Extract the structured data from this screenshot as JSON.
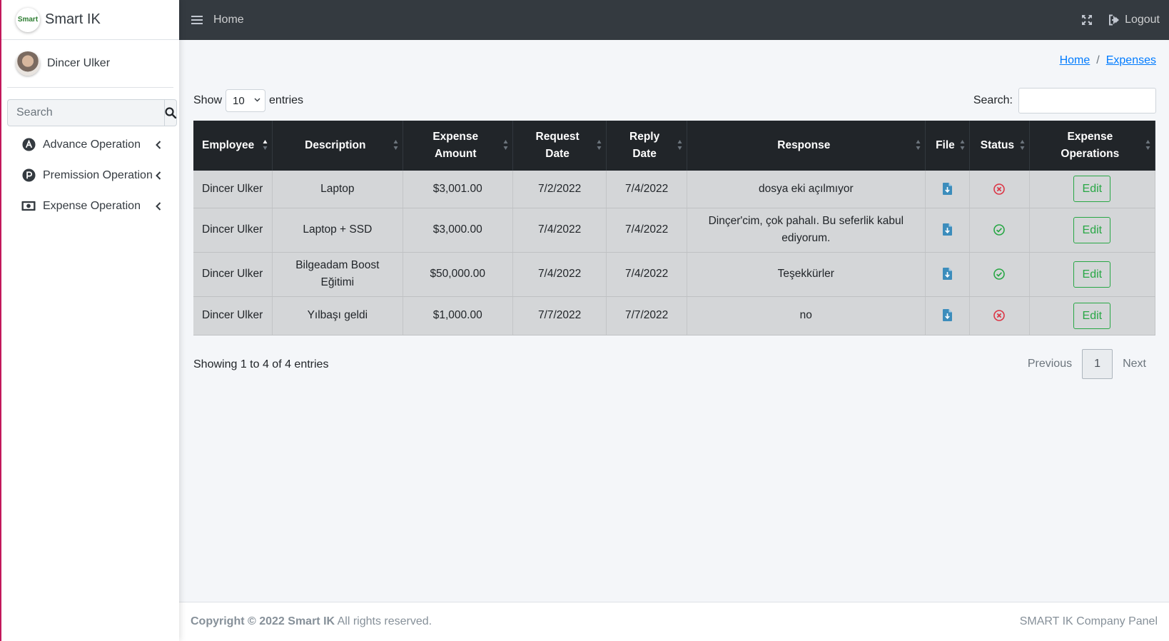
{
  "brand": {
    "name": "Smart IK",
    "logo_text": "Smart"
  },
  "user": {
    "name": "Dincer Ulker"
  },
  "sidebar": {
    "search_placeholder": "Search",
    "items": [
      {
        "label": "Advance Operation",
        "icon": "advance-icon"
      },
      {
        "label": "Premission Operation",
        "icon": "permission-icon"
      },
      {
        "label": "Expense Operation",
        "icon": "money-icon"
      }
    ]
  },
  "topbar": {
    "home": "Home",
    "logout": "Logout"
  },
  "breadcrumb": {
    "home": "Home",
    "sep": "/",
    "current": "Expenses"
  },
  "table_controls": {
    "show": "Show",
    "page_size": "10",
    "entries": "entries",
    "search_label": "Search:"
  },
  "table": {
    "columns": [
      [
        "Employee"
      ],
      [
        "Description"
      ],
      [
        "Expense",
        "Amount"
      ],
      [
        "Request",
        "Date"
      ],
      [
        "Reply",
        "Date"
      ],
      [
        "Response"
      ],
      [
        "File"
      ],
      [
        "Status"
      ],
      [
        "Expense",
        "Operations"
      ]
    ],
    "edit_label": "Edit",
    "rows": [
      {
        "employee": "Dincer Ulker",
        "description": "Laptop",
        "amount": "$3,001.00",
        "request_date": "7/2/2022",
        "reply_date": "7/4/2022",
        "response": "dosya eki açılmıyor",
        "status": "rejected"
      },
      {
        "employee": "Dincer Ulker",
        "description": "Laptop + SSD",
        "amount": "$3,000.00",
        "request_date": "7/4/2022",
        "reply_date": "7/4/2022",
        "response": "Dinçer'cim, çok pahalı. Bu seferlik kabul ediyorum.",
        "status": "approved"
      },
      {
        "employee": "Dincer Ulker",
        "description": "Bilgeadam Boost Eğitimi",
        "amount": "$50,000.00",
        "request_date": "7/4/2022",
        "reply_date": "7/4/2022",
        "response": "Teşekkürler",
        "status": "approved"
      },
      {
        "employee": "Dincer Ulker",
        "description": "Yılbaşı geldi",
        "amount": "$1,000.00",
        "request_date": "7/7/2022",
        "reply_date": "7/7/2022",
        "response": "no",
        "status": "rejected"
      }
    ]
  },
  "info": "Showing 1 to 4 of 4 entries",
  "pagination": {
    "previous": "Previous",
    "current": "1",
    "next": "Next"
  },
  "footer": {
    "copyright_prefix": "Copyright © 2022 Smart IK",
    "copyright_suffix": " All rights reserved.",
    "right": "SMART IK Company Panel"
  },
  "colors": {
    "topbar": "#343a40",
    "table_header": "#212529",
    "row_bg": "#d4d6d8",
    "link": "#007bff",
    "success": "#28a745",
    "danger": "#dc3545",
    "file_icon": "#3c8dbc"
  }
}
